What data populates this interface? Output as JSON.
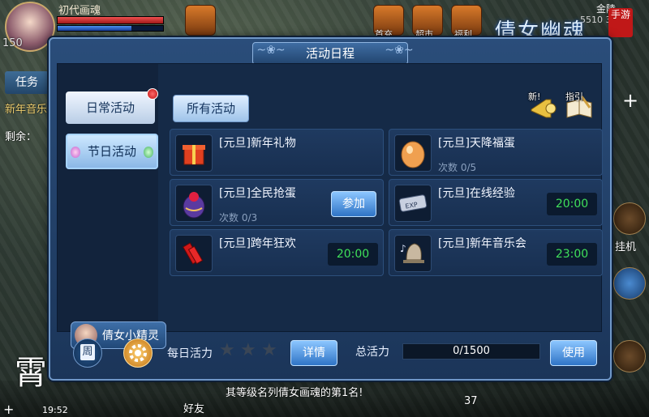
{
  "hud": {
    "player_name": "初代画魂",
    "level": "150",
    "gold_label": "金陵",
    "gold_value": "5510 3731",
    "icons": [
      "首充",
      "超市",
      "福利"
    ],
    "logo_text": "倩女幽魂",
    "logo_sub": "手游"
  },
  "left_panel": {
    "task_tab": "任务",
    "event_text": "新年音乐",
    "remaining": "剩余："
  },
  "right_panel": {
    "hang_label": "挂机"
  },
  "chat": {
    "line": "其等级名列倩女画魂的第1名!",
    "friends": "好友",
    "time": "19:52",
    "count": "37"
  },
  "dialog": {
    "title": "活动日程",
    "categories": [
      {
        "label": "日常活动",
        "has_dot": true
      },
      {
        "label": "节日活动",
        "has_dot": false
      }
    ],
    "sprite_button": "倩女小精灵",
    "filter_button": "所有活动",
    "tools": [
      {
        "label": "新!",
        "icon": "horn-icon"
      },
      {
        "label": "指引",
        "icon": "book-icon"
      }
    ],
    "activities": [
      {
        "name": "[元旦]新年礼物",
        "sub": "",
        "time": "",
        "action": "",
        "icon": "gift-box-icon"
      },
      {
        "name": "[元旦]天降福蛋",
        "sub": "次数 0/5",
        "time": "",
        "action": "",
        "icon": "golden-egg-icon"
      },
      {
        "name": "[元旦]全民抢蛋",
        "sub": "次数 0/3",
        "time": "",
        "action": "参加",
        "icon": "egg-basket-icon"
      },
      {
        "name": "[元旦]在线经验",
        "sub": "",
        "time": "20:00",
        "action": "",
        "icon": "exp-scroll-icon"
      },
      {
        "name": "[元旦]跨年狂欢",
        "sub": "",
        "time": "20:00",
        "action": "",
        "icon": "firecracker-icon"
      },
      {
        "name": "[元旦]新年音乐会",
        "sub": "",
        "time": "23:00",
        "action": "",
        "icon": "bell-icon"
      }
    ],
    "footer": {
      "week_label": "周",
      "daily_label": "每日活力",
      "stars_total": 3,
      "stars_filled": 0,
      "detail_button": "详情",
      "total_label": "总活力",
      "total_value": "0/1500",
      "use_button": "使用"
    }
  },
  "colors": {
    "timer_green": "#3fe05a",
    "dot_red": "#e02020"
  }
}
